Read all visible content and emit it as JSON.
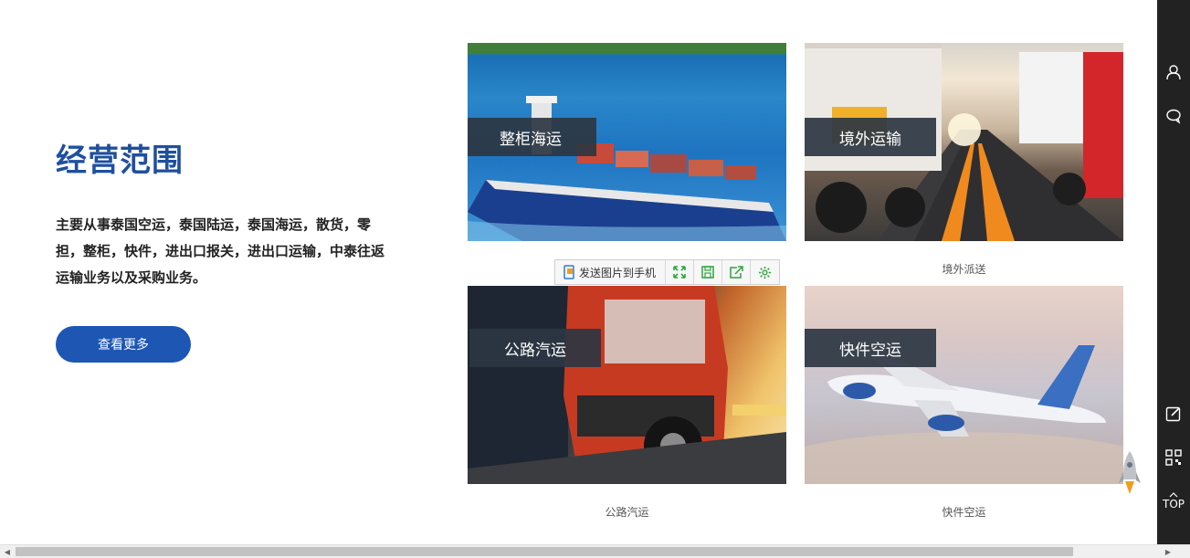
{
  "intro": {
    "title": "经营范围",
    "description": "主要从事泰国空运，泰国陆运，泰国海运，散货，零担，整柜，快件，进出口报关，进出口运输，中泰往返运输业务以及采购业务。",
    "more_button": "查看更多"
  },
  "cards": [
    {
      "label": "整柜海运",
      "caption": ""
    },
    {
      "label": "境外运输",
      "caption": "境外派送"
    },
    {
      "label": "公路汽运",
      "caption": "公路汽运"
    },
    {
      "label": "快件空运",
      "caption": "快件空运"
    }
  ],
  "image_toolbar": {
    "send_label": "发送图片到手机",
    "icons": [
      "send-to-phone-icon",
      "fullscreen-icon",
      "save-icon",
      "share-icon",
      "settings-icon"
    ],
    "icon_color": "#2aa63a"
  },
  "sidebar": {
    "icons": [
      "user-icon",
      "chat-icon",
      "edit-icon",
      "qrcode-icon"
    ],
    "top_label": "TOP"
  },
  "colors": {
    "title": "#1f4f9e",
    "button": "#1d56b3",
    "label_bg": "#2c3642",
    "sidebar": "#222222"
  }
}
